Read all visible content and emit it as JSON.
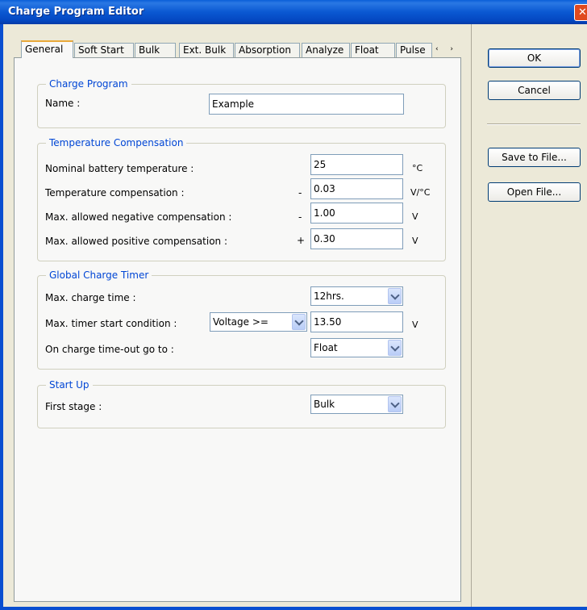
{
  "window": {
    "title": "Charge Program Editor",
    "close_glyph": "✕"
  },
  "tabs": [
    "General",
    "Soft Start",
    "Bulk",
    "Ext. Bulk",
    "Absorption",
    "Analyze",
    "Float",
    "Pulse"
  ],
  "tab_scroll": "‹ ›",
  "buttons": {
    "ok": "OK",
    "cancel": "Cancel",
    "save": "Save to File...",
    "open": "Open File..."
  },
  "charge_program": {
    "title": "Charge Program",
    "name_label": "Name :",
    "name_value": "Example"
  },
  "temperature": {
    "title": "Temperature Compensation",
    "nominal_label": "Nominal battery temperature :",
    "nominal_value": "25",
    "nominal_unit": "°C",
    "comp_label": "Temperature compensation :",
    "comp_sign": "-",
    "comp_value": "0.03",
    "comp_unit": "V/°C",
    "neg_label": "Max. allowed negative compensation :",
    "neg_sign": "-",
    "neg_value": "1.00",
    "neg_unit": "V",
    "pos_label": "Max. allowed positive compensation :",
    "pos_sign": "+",
    "pos_value": "0.30",
    "pos_unit": "V"
  },
  "timer": {
    "title": "Global Charge Timer",
    "max_time_label": "Max. charge time :",
    "max_time_value": "12hrs.",
    "start_label": "Max. timer start condition :",
    "start_condition": "Voltage >=",
    "start_value": "13.50",
    "start_unit": "V",
    "timeout_label": "On charge time-out go to :",
    "timeout_value": "Float"
  },
  "startup": {
    "title": "Start Up",
    "first_label": "First stage :",
    "first_value": "Bulk"
  },
  "icons": {
    "close": "close-icon",
    "dropdown": "chevron-down-icon"
  }
}
